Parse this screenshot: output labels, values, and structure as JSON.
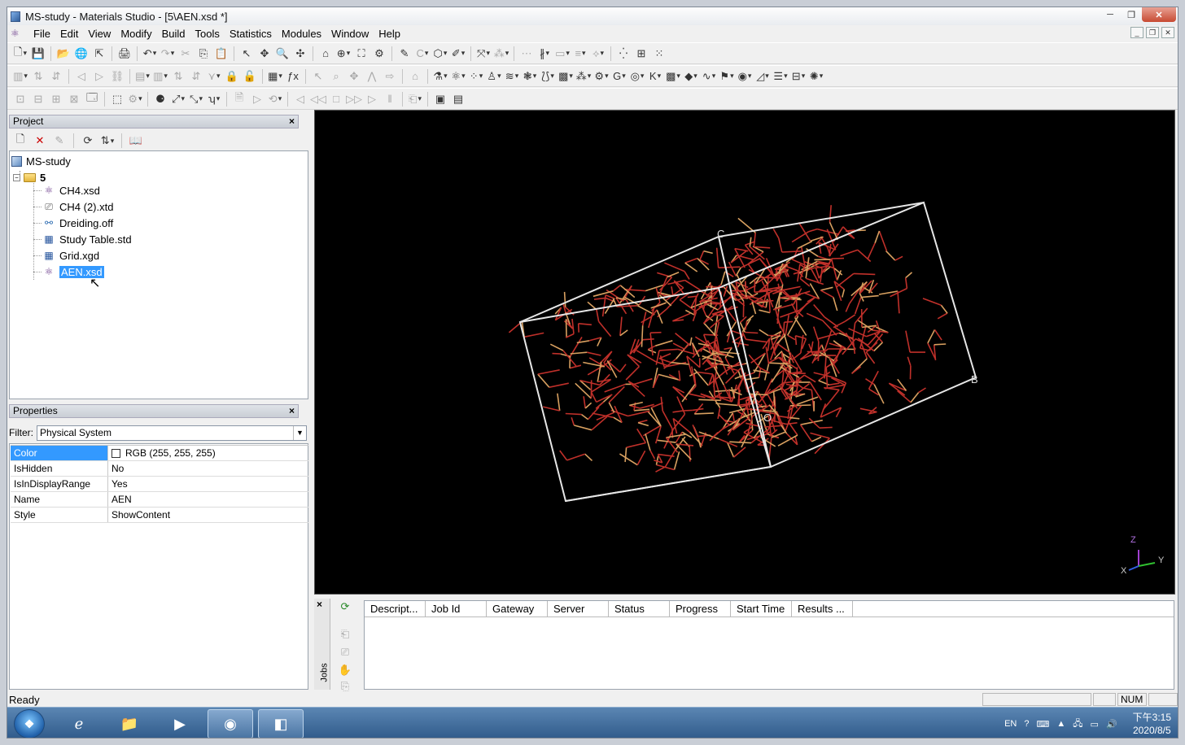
{
  "window": {
    "title": "MS-study - Materials Studio - [5\\AEN.xsd *]"
  },
  "menu": [
    "File",
    "Edit",
    "View",
    "Modify",
    "Build",
    "Tools",
    "Statistics",
    "Modules",
    "Window",
    "Help"
  ],
  "project": {
    "header": "Project",
    "close": "×",
    "root": "MS-study",
    "folder": "5",
    "files": [
      {
        "name": "CH4.xsd",
        "icon": "molecule-icon"
      },
      {
        "name": "CH4 (2).xtd",
        "icon": "trajectory-icon"
      },
      {
        "name": "Dreiding.off",
        "icon": "forcefield-icon"
      },
      {
        "name": "Study Table.std",
        "icon": "table-icon"
      },
      {
        "name": "Grid.xgd",
        "icon": "grid-icon"
      },
      {
        "name": "AEN.xsd",
        "icon": "molecule-icon"
      }
    ]
  },
  "properties": {
    "header": "Properties",
    "close": "×",
    "filter_label": "Filter:",
    "filter_value": "Physical System",
    "rows": [
      {
        "key": "Color",
        "value": "RGB (255, 255, 255)"
      },
      {
        "key": "IsHidden",
        "value": "No"
      },
      {
        "key": "IsInDisplayRange",
        "value": "Yes"
      },
      {
        "key": "Name",
        "value": "AEN"
      },
      {
        "key": "Style",
        "value": "ShowContent"
      }
    ]
  },
  "viewer": {
    "axis_labels": {
      "c": "C",
      "b": "B",
      "o": "O"
    },
    "triad": {
      "z": "Z",
      "y": "Y",
      "x": "X"
    }
  },
  "jobs": {
    "close": "×",
    "label": "Jobs",
    "columns": [
      "Descript...",
      "Job Id",
      "Gateway",
      "Server",
      "Status",
      "Progress",
      "Start Time",
      "Results ..."
    ]
  },
  "status": {
    "text": "Ready",
    "num": "NUM"
  },
  "taskbar": {
    "lang": "EN",
    "time": "下午3:15",
    "date": "2020/8/5"
  },
  "colors": {
    "viewer_bg": "#000000",
    "bond_oxygen": "#c0302a",
    "bond_al": "#d8a060",
    "cell": "#e8e8e8",
    "selection": "#3399ff"
  }
}
